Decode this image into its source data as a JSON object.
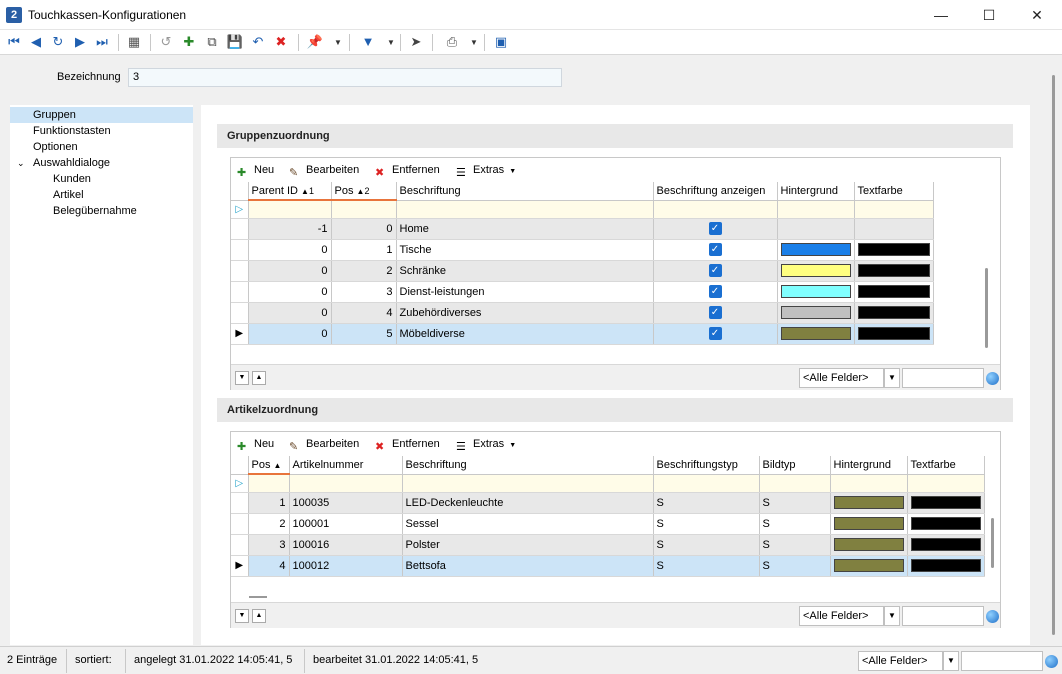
{
  "window": {
    "title": "Touchkassen-Konfigurationen"
  },
  "form": {
    "bezeichnung_label": "Bezeichnung",
    "bezeichnung_value": "3"
  },
  "tree": [
    {
      "label": "Gruppen",
      "level": 0,
      "selected": true
    },
    {
      "label": "Funktionstasten",
      "level": 0
    },
    {
      "label": "Optionen",
      "level": 0
    },
    {
      "label": "Auswahldialoge",
      "level": 0,
      "expanded": true
    },
    {
      "label": "Kunden",
      "level": 1
    },
    {
      "label": "Artikel",
      "level": 1
    },
    {
      "label": "Belegübernahme",
      "level": 1
    }
  ],
  "grid_toolbar": {
    "neu": "Neu",
    "bearbeiten": "Bearbeiten",
    "entfernen": "Entfernen",
    "extras": "Extras"
  },
  "gruppen": {
    "title": "Gruppenzuordnung",
    "columns": {
      "parent_id": "Parent ID",
      "parent_sort": "1",
      "pos": "Pos",
      "pos_sort": "2",
      "beschriftung": "Beschriftung",
      "anzeigen": "Beschriftung anzeigen",
      "hintergrund": "Hintergrund",
      "textfarbe": "Textfarbe"
    },
    "rows": [
      {
        "parent_id": "-1",
        "pos": "0",
        "beschriftung": "Home",
        "anzeigen": true,
        "bg": "",
        "fg": ""
      },
      {
        "parent_id": "0",
        "pos": "1",
        "beschriftung": "Tische",
        "anzeigen": true,
        "bg": "#1a7fe8",
        "fg": "#000000"
      },
      {
        "parent_id": "0",
        "pos": "2",
        "beschriftung": "Schränke",
        "anzeigen": true,
        "bg": "#ffff80",
        "fg": "#000000"
      },
      {
        "parent_id": "0",
        "pos": "3",
        "beschriftung": "Dienst-leistungen",
        "anzeigen": true,
        "bg": "#80ffff",
        "fg": "#000000"
      },
      {
        "parent_id": "0",
        "pos": "4",
        "beschriftung": "Zubehördiverses",
        "anzeigen": true,
        "bg": "#c0c0c0",
        "fg": "#000000"
      },
      {
        "parent_id": "0",
        "pos": "5",
        "beschriftung": "Möbeldiverse",
        "anzeigen": true,
        "bg": "#808040",
        "fg": "#000000"
      }
    ],
    "filter": "<Alle Felder>"
  },
  "artikel": {
    "title": "Artikelzuordnung",
    "columns": {
      "pos": "Pos",
      "artikelnummer": "Artikelnummer",
      "beschriftung": "Beschriftung",
      "beschriftungstyp": "Beschriftungstyp",
      "bildtyp": "Bildtyp",
      "hintergrund": "Hintergrund",
      "textfarbe": "Textfarbe"
    },
    "rows": [
      {
        "pos": "1",
        "artikelnummer": "100035",
        "beschriftung": "LED-Deckenleuchte",
        "beschriftungstyp": "S",
        "bildtyp": "S",
        "bg": "#808040",
        "fg": "#000000"
      },
      {
        "pos": "2",
        "artikelnummer": "100001",
        "beschriftung": "Sessel",
        "beschriftungstyp": "S",
        "bildtyp": "S",
        "bg": "#808040",
        "fg": "#000000"
      },
      {
        "pos": "3",
        "artikelnummer": "100016",
        "beschriftung": "Polster",
        "beschriftungstyp": "S",
        "bildtyp": "S",
        "bg": "#808040",
        "fg": "#000000"
      },
      {
        "pos": "4",
        "artikelnummer": "100012",
        "beschriftung": "Bettsofa",
        "beschriftungstyp": "S",
        "bildtyp": "S",
        "bg": "#808040",
        "fg": "#000000"
      }
    ],
    "filter": "<Alle Felder>"
  },
  "status": {
    "count": "2 Einträge",
    "sortiert": "sortiert:",
    "angelegt": "angelegt 31.01.2022 14:05:41,  5",
    "bearbeitet": "bearbeitet 31.01.2022 14:05:41,  5",
    "filter": "<Alle Felder>"
  },
  "colors": {
    "selection": "#cce4f7",
    "accent": "#1a6fd1",
    "sort_marker": "#e8743b"
  }
}
